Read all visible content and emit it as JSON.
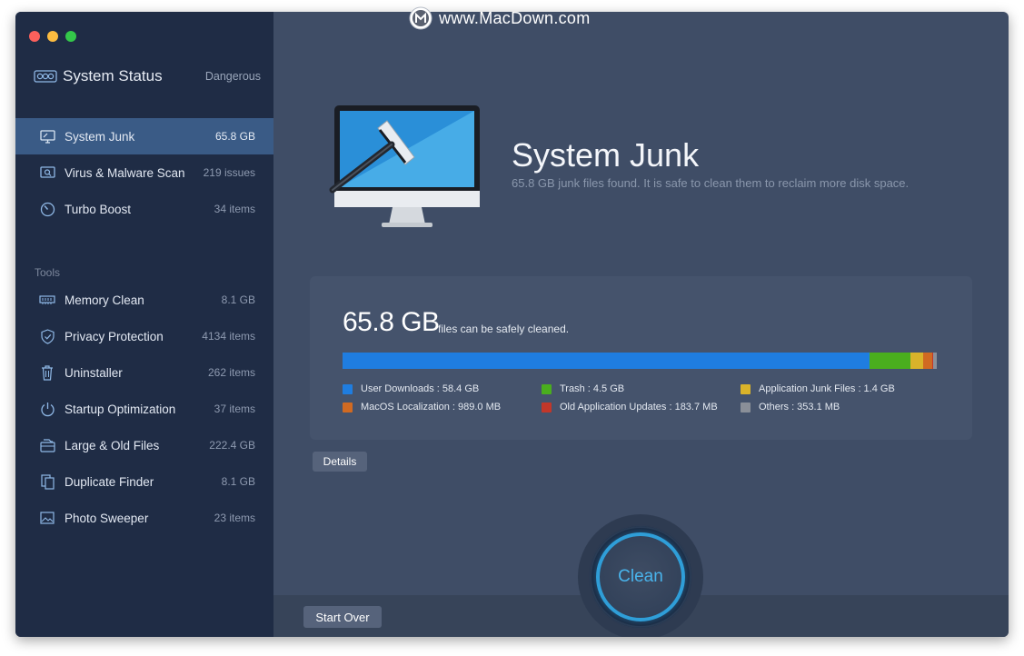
{
  "watermark": {
    "text": "www.MacDown.com"
  },
  "sidebar": {
    "status_title": "System Status",
    "status_value": "Dangerous",
    "items": [
      {
        "label": "System Junk",
        "value": "65.8 GB",
        "icon": "monitor-icon",
        "active": true
      },
      {
        "label": "Virus & Malware Scan",
        "value": "219 issues",
        "icon": "virus-scan-icon"
      },
      {
        "label": "Turbo Boost",
        "value": "34 items",
        "icon": "speedometer-icon"
      }
    ],
    "tools_heading": "Tools",
    "tools": [
      {
        "label": "Memory Clean",
        "value": "8.1 GB",
        "icon": "memory-chip-icon"
      },
      {
        "label": "Privacy Protection",
        "value": "4134 items",
        "icon": "shield-icon"
      },
      {
        "label": "Uninstaller",
        "value": "262 items",
        "icon": "trash-icon"
      },
      {
        "label": "Startup Optimization",
        "value": "37 items",
        "icon": "power-icon"
      },
      {
        "label": "Large & Old Files",
        "value": "222.4 GB",
        "icon": "files-stack-icon"
      },
      {
        "label": "Duplicate Finder",
        "value": "8.1 GB",
        "icon": "duplicate-icon"
      },
      {
        "label": "Photo Sweeper",
        "value": "23 items",
        "icon": "photo-icon"
      }
    ]
  },
  "main": {
    "title": "System Junk",
    "subtitle": "65.8 GB junk files found.  It is safe to clean them to reclaim more disk space.",
    "summary": {
      "size": "65.8 GB",
      "text": "files can be safely cleaned."
    },
    "breakdown": [
      {
        "label": "User Downloads : 58.4 GB",
        "gb": 58.4,
        "color": "#1f7de0"
      },
      {
        "label": "Trash : 4.5 GB",
        "gb": 4.5,
        "color": "#4aae1e"
      },
      {
        "label": "Application Junk Files : 1.4 GB",
        "gb": 1.4,
        "color": "#d9b32a"
      },
      {
        "label": "MacOS Localization : 989.0 MB",
        "gb": 0.989,
        "color": "#d06a22"
      },
      {
        "label": "Old Application Updates : 183.7 MB",
        "gb": 0.1837,
        "color": "#c2372a"
      },
      {
        "label": "Others : 353.1 MB",
        "gb": 0.3531,
        "color": "#8a8f98"
      }
    ],
    "details_label": "Details",
    "clean_label": "Clean",
    "start_over_label": "Start Over"
  }
}
